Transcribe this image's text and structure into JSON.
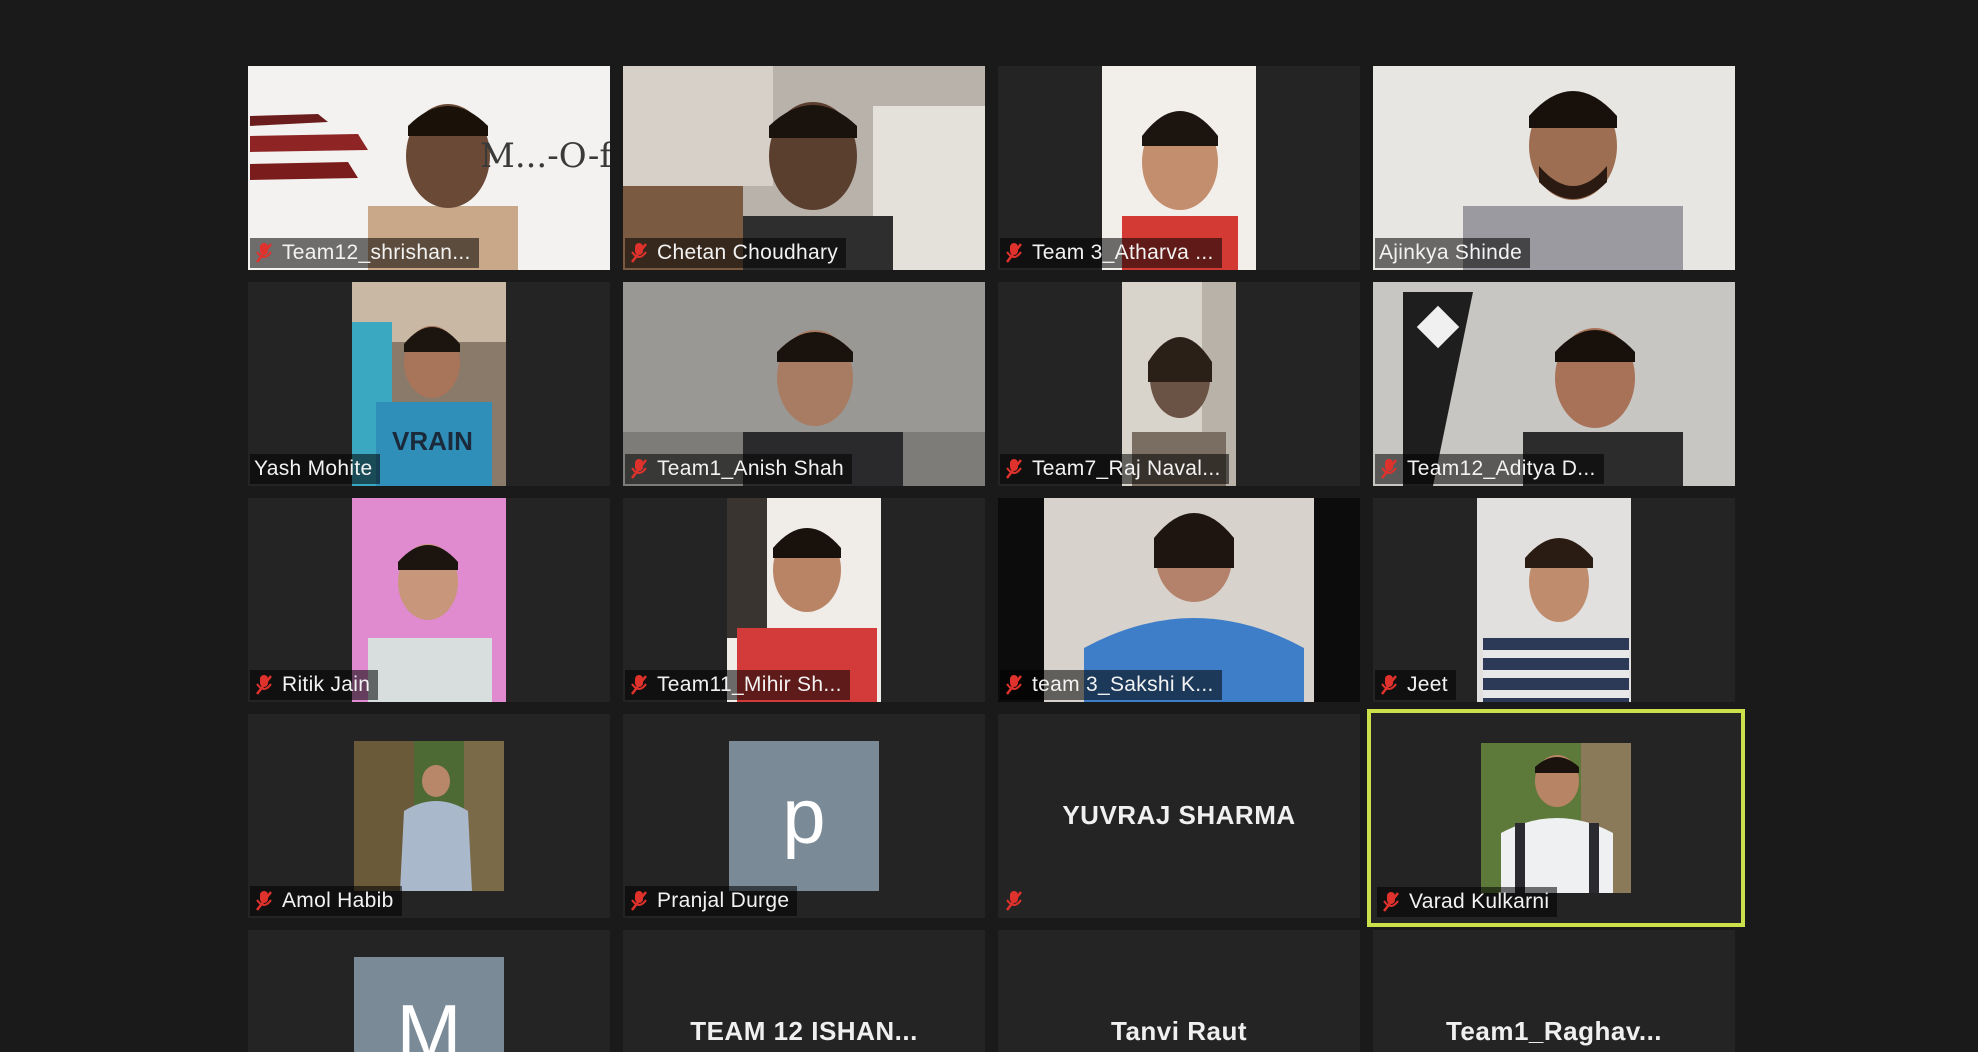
{
  "meeting": {
    "participants": [
      {
        "name": "Team12_shrishan...",
        "video": true,
        "mic_muted": true
      },
      {
        "name": "Chetan Choudhary",
        "video": true,
        "mic_muted": true
      },
      {
        "name": "Team 3_Atharva ...",
        "video": true,
        "mic_muted": true
      },
      {
        "name": "Ajinkya Shinde",
        "video": true,
        "mic_muted": false
      },
      {
        "name": "Yash Mohite",
        "video": true,
        "mic_muted": false
      },
      {
        "name": "Team1_Anish Shah",
        "video": true,
        "mic_muted": true
      },
      {
        "name": "Team7_Raj Naval...",
        "video": true,
        "mic_muted": true
      },
      {
        "name": "Team12_Aditya D...",
        "video": true,
        "mic_muted": true
      },
      {
        "name": "Ritik Jain",
        "video": true,
        "mic_muted": true
      },
      {
        "name": "Team11_Mihir Sh...",
        "video": true,
        "mic_muted": true
      },
      {
        "name": "team 3_Sakshi K...",
        "video": true,
        "mic_muted": true
      },
      {
        "name": "Jeet",
        "video": true,
        "mic_muted": true
      },
      {
        "name": "Amol Habib",
        "video": true,
        "mic_muted": true
      },
      {
        "name": "Pranjal Durge",
        "video": false,
        "avatar_letter": "p",
        "mic_muted": true
      },
      {
        "name": "YUVRAJ SHARMA",
        "video": false,
        "mic_muted": true
      },
      {
        "name": "Varad Kulkarni",
        "video": true,
        "mic_muted": true,
        "active_speaker": true
      },
      {
        "name": "M",
        "video": false,
        "avatar_letter": "M"
      },
      {
        "name": "TEAM 12 ISHAN...",
        "video": false
      },
      {
        "name": "Tanvi Raut",
        "video": false
      },
      {
        "name": "Team1_Raghav...",
        "video": false
      }
    ],
    "banner_text": "M...-O-free",
    "colors": {
      "background": "#1a1a1a",
      "tile": "#242424",
      "active_border": "#cbe04a",
      "muted_icon": "#e0322d",
      "avatar": "#7a8a96"
    }
  }
}
